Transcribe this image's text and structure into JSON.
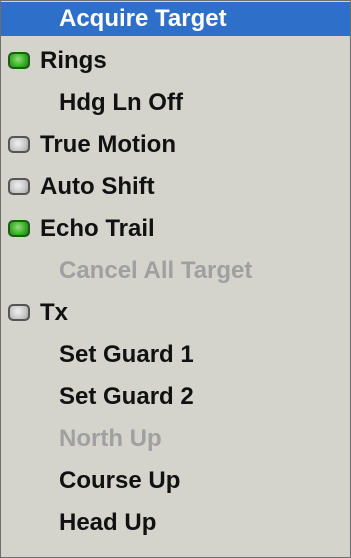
{
  "menu": {
    "accent_color": "#2e6fc9",
    "indicator_on_color": "#3fb02c",
    "indicator_off_color": "#c8c8c8",
    "items": [
      {
        "label": "Acquire Target",
        "state": "selected",
        "indicator": "none"
      },
      {
        "label": "Rings",
        "state": "enabled",
        "indicator": "on"
      },
      {
        "label": "Hdg Ln Off",
        "state": "enabled",
        "indicator": "none"
      },
      {
        "label": "True Motion",
        "state": "enabled",
        "indicator": "off"
      },
      {
        "label": "Auto Shift",
        "state": "enabled",
        "indicator": "off"
      },
      {
        "label": "Echo Trail",
        "state": "enabled",
        "indicator": "on"
      },
      {
        "label": "Cancel All Target",
        "state": "disabled",
        "indicator": "none"
      },
      {
        "label": "Tx",
        "state": "enabled",
        "indicator": "off"
      },
      {
        "label": "Set Guard 1",
        "state": "enabled",
        "indicator": "none"
      },
      {
        "label": "Set Guard 2",
        "state": "enabled",
        "indicator": "none"
      },
      {
        "label": "North Up",
        "state": "disabled",
        "indicator": "none"
      },
      {
        "label": "Course Up",
        "state": "enabled",
        "indicator": "none"
      },
      {
        "label": "Head Up",
        "state": "enabled",
        "indicator": "none"
      }
    ]
  }
}
